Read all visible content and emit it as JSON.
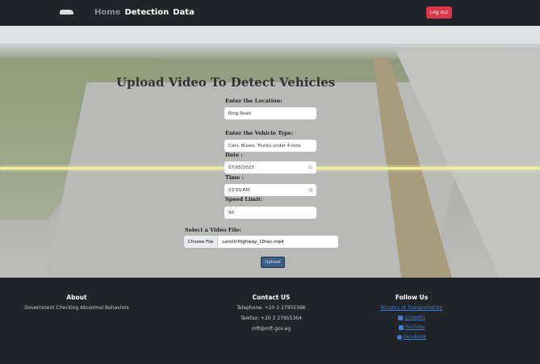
{
  "nav": {
    "links": [
      "Home",
      "Detection",
      "Data"
    ],
    "logout": "Log out"
  },
  "main": {
    "title": "Upload Video To Detect Vehicles",
    "location_label": "Enter the Location:",
    "location_value": "Ring Road",
    "vehicle_label": "Enter the Vehicle Type:",
    "vehicle_value": "Cars, Buses, Trucks under 4 tons",
    "date_label": "Date :",
    "date_value": "07/05/2023",
    "time_label": "Time :",
    "time_value": "03:50 AM",
    "speed_label": "Speed Limit:",
    "speed_value": "90",
    "file_label": "Select a Video File:",
    "file_button": "Choose File",
    "file_name": "carsOnHighway_10sec.mp4",
    "upload": "Upload"
  },
  "footer": {
    "about": {
      "title": "About",
      "text": "Government Checking Abnormal Behaviors"
    },
    "contact": {
      "title": "Contact US",
      "telephone": "Telephone: +20 2 27955366",
      "telefax": "Telefax: +20 2 27955364",
      "email": "mft@mft.gov.eg"
    },
    "follow": {
      "title": "Follow Us",
      "links": [
        "Ministry of Transportation",
        "LinkedIn",
        "YouTube",
        "Facebook"
      ]
    }
  }
}
